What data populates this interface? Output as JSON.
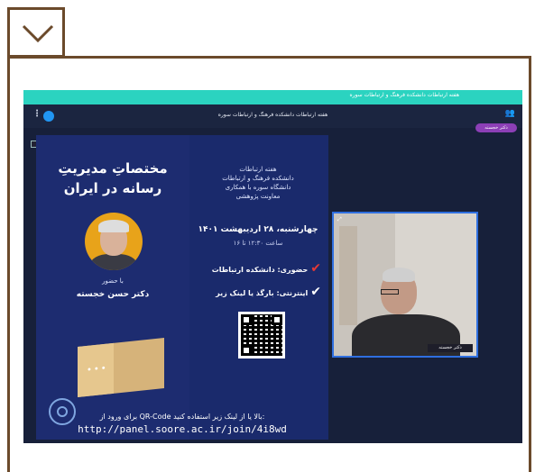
{
  "expand_icon": "chevron-down-icon",
  "meeting": {
    "banner_text": "هفته ارتباطات دانشکده فرهنگ و ارتباطات سوره",
    "title": "هفته ارتباطات دانشکده فرهنگ و ارتباطات سوره",
    "presenter_pill": "دکتر خجسته"
  },
  "poster": {
    "title_line1": "مختصاتِ مدیریتِ",
    "title_line2": "رسانه در ایران",
    "with_presence": "با حضور",
    "speaker_name": "دکتر حسن خجسته",
    "header_lines": [
      "هفته ارتباطات",
      "دانشکده فرهنگ و ارتباطات",
      "دانشگاه سوره با همکاری",
      "معاونت پژوهشی"
    ],
    "date": "چهارشنبه، ۲۸ اردیبهشت ۱۴۰۱",
    "time": "ساعت ۱۲:۳۰ تا ۱۶",
    "in_person": "حضوری: دانشکده ارتباطات",
    "online": "اینترنتی: بارگذ یا لینک زیر",
    "join_instruction": "برای ورود از QR-Code بالا یا از لینک زیر استفاده کنید:",
    "join_url": "http://panel.soore.ac.ir/join/4i8wd"
  },
  "webcam": {
    "name_tag": "دکتر خجسته"
  },
  "colors": {
    "frame_border": "#6b4a2b",
    "teal_bar": "#2bd3c0",
    "poster_bg": "#1a2a6c",
    "pill": "#8c3fb6",
    "cam_border": "#2f6fe0"
  }
}
